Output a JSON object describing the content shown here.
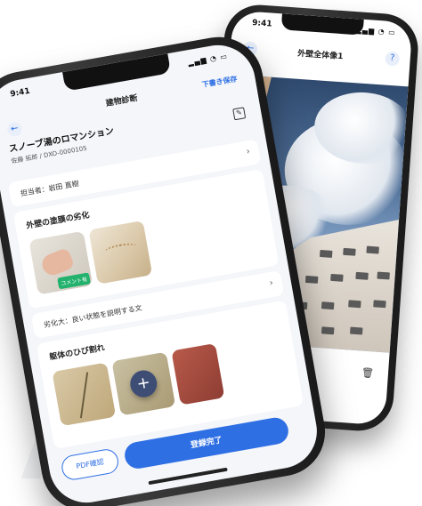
{
  "back_phone": {
    "status_time": "9:41",
    "title": "外壁全体像1",
    "back_icon": "arrow-left-icon",
    "help_icon": "question-circle-icon",
    "trash_icon": "trash-icon"
  },
  "front_phone": {
    "status_time": "9:41",
    "title": "建物診断",
    "save_draft": "下書き保存",
    "property_name": "スノーブ湯のロマンション",
    "property_meta": "佐藤 拓郎 / DXO-0000105",
    "assignee": "担当者：岩田 直樹",
    "section1_title": "外壁の塗膜の劣化",
    "comment_badge": "コメント有",
    "section1_note": "劣化大：良い状態を説明する文",
    "section2_title": "躯体のひび割れ",
    "pdf_button": "PDF確認",
    "complete_button": "登録完了"
  },
  "colors": {
    "accent": "#2f6fe4",
    "badge": "#23b26d",
    "fab": "#3d4d74"
  }
}
